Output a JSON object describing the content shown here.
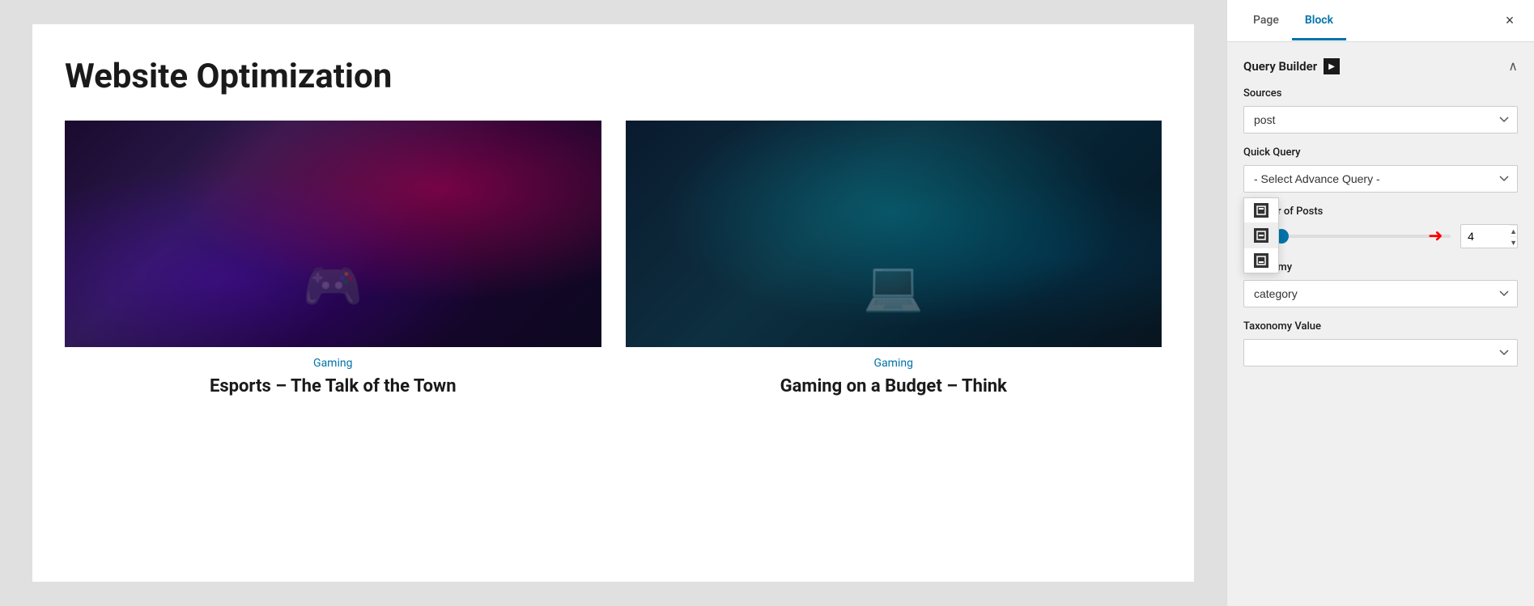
{
  "page": {
    "title": "Website Optimization"
  },
  "posts": [
    {
      "category": "Gaming",
      "title": "Esports – The Talk of the Town",
      "imageClass": "post-image-gaming1"
    },
    {
      "category": "Gaming",
      "title": "Gaming on a Budget – Think",
      "imageClass": "post-image-gaming2"
    }
  ],
  "sidebar": {
    "tabs": [
      {
        "label": "Page",
        "active": false
      },
      {
        "label": "Block",
        "active": true
      }
    ],
    "close_label": "×",
    "section_title": "Query Builder",
    "section_icon_label": "▶",
    "sources_label": "Sources",
    "sources_value": "post",
    "quick_query_label": "Quick Query",
    "quick_query_value": "- Select Advance Query -",
    "number_of_posts_label": "Number of Posts",
    "number_of_posts_value": "4",
    "taxonomy_label": "Taxonomy",
    "taxonomy_value": "category",
    "taxonomy_value_label": "Taxonomy Value",
    "taxonomy_value_value": ""
  },
  "popup": {
    "items": [
      "▣",
      "▣",
      "▣"
    ]
  }
}
